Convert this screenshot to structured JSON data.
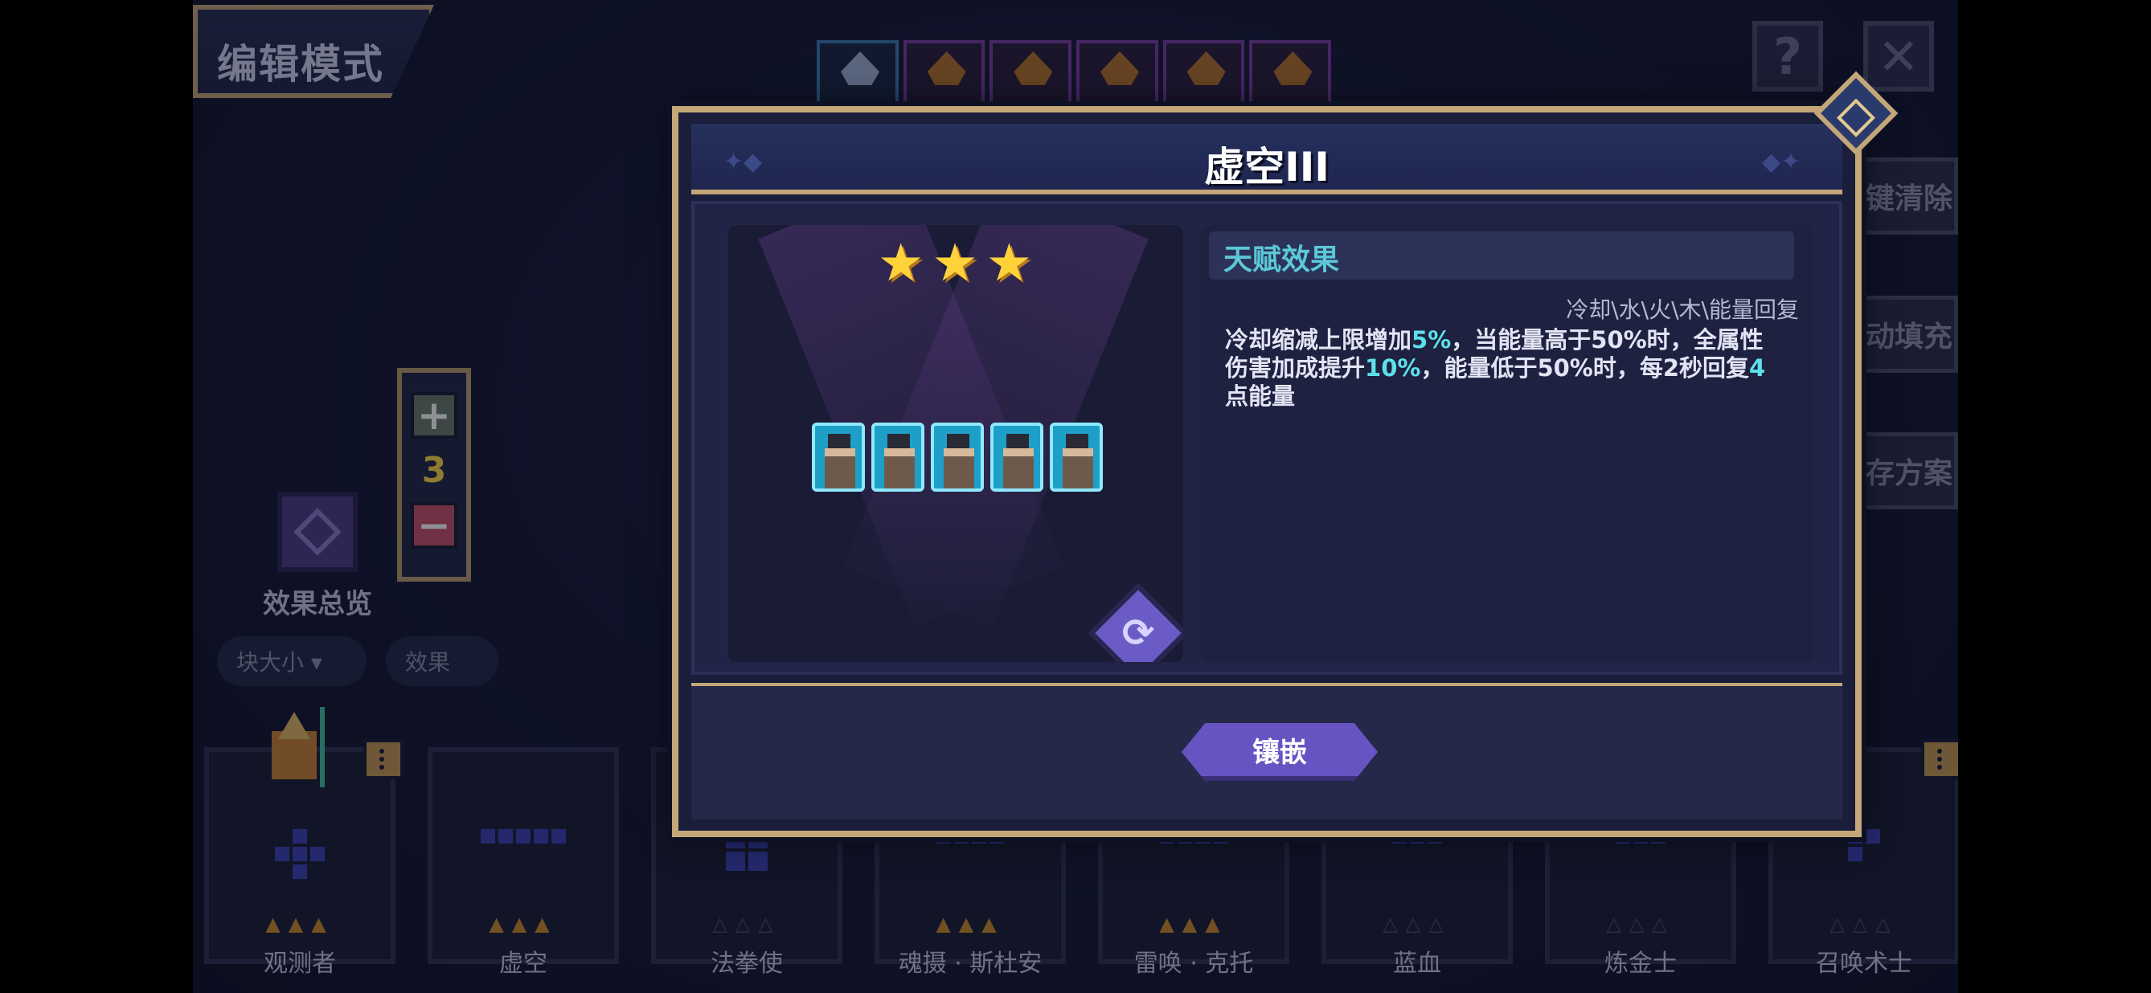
{
  "edit_mode_label": "编辑模式",
  "side_buttons": [
    {
      "label": "一键清除",
      "icon": "orange-diamond-icon",
      "color": "#c98a2e"
    },
    {
      "label": "自动填充",
      "icon": "purple-diamond-icon",
      "color": "#7b54c8"
    },
    {
      "label": "保存方案",
      "icon": "green-diamond-icon",
      "color": "#5fa83a"
    }
  ],
  "count_panel": {
    "plus": "+",
    "value": "3",
    "minus": "−"
  },
  "effect_overview_label": "效果总览",
  "filters": {
    "block_size": "块大小 ▾",
    "effect": "效果"
  },
  "cards": [
    {
      "name": "观测者",
      "stars": "▲▲▲"
    },
    {
      "name": "虚空",
      "stars": "▲▲▲"
    },
    {
      "name": "法拳使",
      "stars": "△△△"
    },
    {
      "name": "魂摄 · 斯杜安",
      "stars": "▲▲▲"
    },
    {
      "name": "雷唤 · 克托",
      "stars": "▲▲▲"
    },
    {
      "name": "蓝血",
      "stars": "△△△"
    },
    {
      "name": "炼金士",
      "stars": "△△△"
    },
    {
      "name": "召唤术士",
      "stars": "△△△"
    }
  ],
  "modal": {
    "title": "虚空III",
    "rotate_symbol": "⟳",
    "talent": {
      "header": "天赋效果",
      "tags": "冷却\\水\\火\\木\\能量回复",
      "desc_parts": [
        "冷却缩减上限增加",
        "5%",
        "，当能量高于50%时，全属性伤害加成提升",
        "10%",
        "，能量低于50%时，每2秒回复",
        "4",
        "点能量"
      ]
    },
    "inlay_label": "镶嵌"
  },
  "colors": {
    "accent_gold": "#c4a679",
    "accent_purple": "#6754c2",
    "highlight_cyan": "#5ee0ea"
  }
}
